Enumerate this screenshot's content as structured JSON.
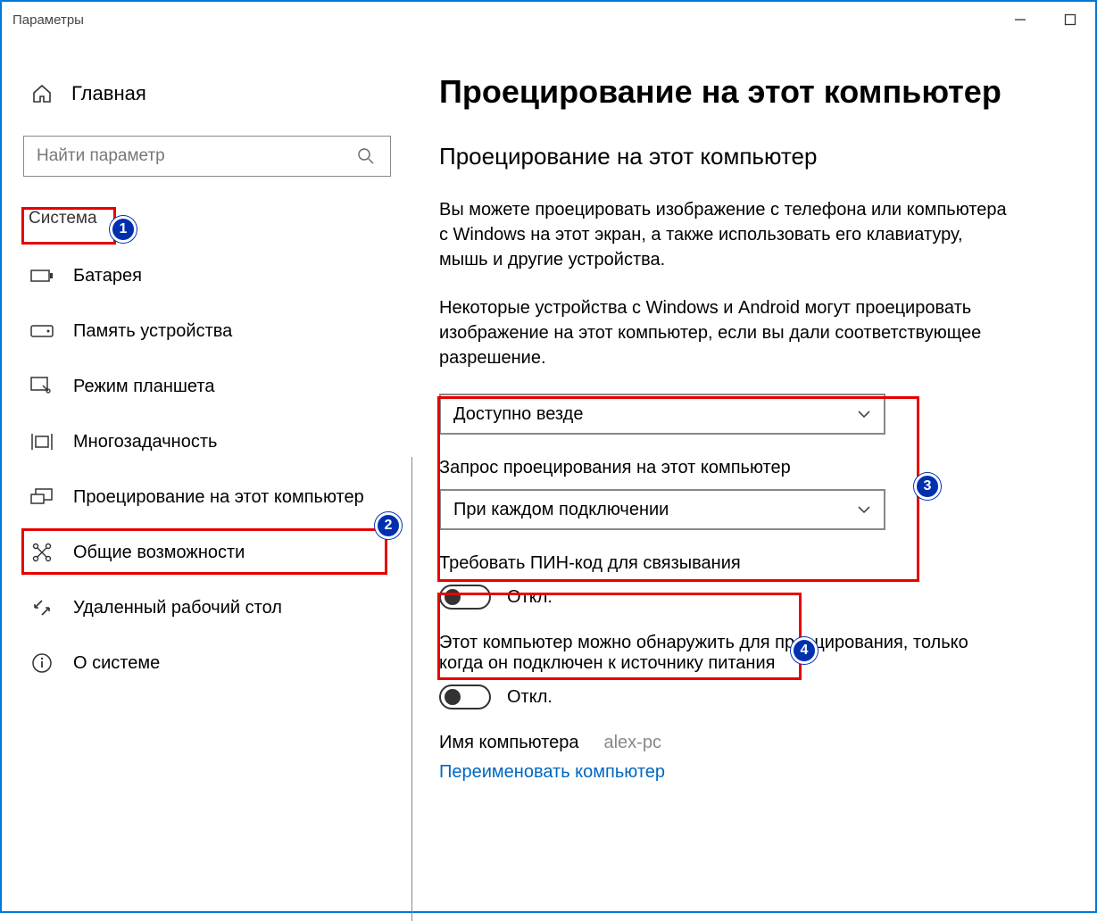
{
  "window": {
    "title": "Параметры"
  },
  "sidebar": {
    "home": "Главная",
    "search_placeholder": "Найти параметр",
    "section": "Система",
    "items": [
      {
        "label": "Батарея"
      },
      {
        "label": "Память устройства"
      },
      {
        "label": "Режим планшета"
      },
      {
        "label": "Многозадачность"
      },
      {
        "label": "Проецирование на этот компьютер"
      },
      {
        "label": "Общие возможности"
      },
      {
        "label": "Удаленный рабочий стол"
      },
      {
        "label": "О системе"
      }
    ]
  },
  "main": {
    "title": "Проецирование на этот компьютер",
    "subtitle": "Проецирование на этот компьютер",
    "desc1": "Вы можете проецировать изображение с телефона или компьютера с Windows на этот экран, а также использовать его клавиатуру, мышь и другие устройства.",
    "desc2": "Некоторые устройства с Windows и Android могут проецировать изображение на этот компьютер, если вы дали соответствующее разрешение.",
    "dropdown1": "Доступно везде",
    "label2": "Запрос проецирования на этот компьютер",
    "dropdown2": "При каждом подключении",
    "pin_label": "Требовать ПИН-код для связывания",
    "pin_state": "Откл.",
    "power_label": "Этот компьютер можно обнаружить для проецирования, только когда он подключен к источнику питания",
    "power_state": "Откл.",
    "pc_name_label": "Имя компьютера",
    "pc_name_value": "alex-pc",
    "rename_link": "Переименовать компьютер"
  },
  "annotations": {
    "b1": "1",
    "b2": "2",
    "b3": "3",
    "b4": "4"
  }
}
